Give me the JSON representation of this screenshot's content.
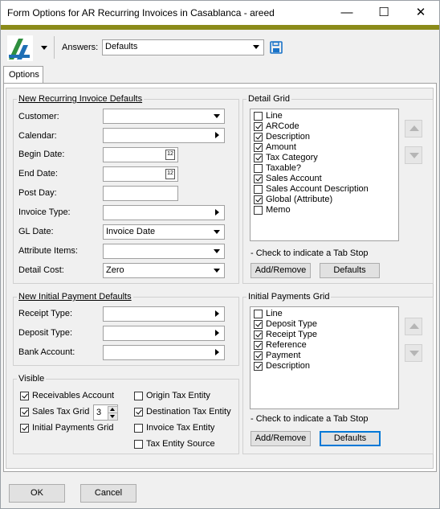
{
  "window": {
    "title": "Form Options for AR Recurring Invoices in Casablanca - areed",
    "minimize_glyph": "—",
    "maximize_glyph": "☐",
    "close_glyph": "✕"
  },
  "toolbar": {
    "answers_label": "Answers:",
    "answers_value": "Defaults",
    "save_icon": "floppy-disk-icon"
  },
  "tabs": [
    {
      "label": "Options"
    }
  ],
  "recurring_defaults": {
    "title": "New Recurring Invoice Defaults",
    "customer_label": "Customer:",
    "customer_value": "",
    "calendar_label": "Calendar:",
    "calendar_value": "",
    "begin_date_label": "Begin Date:",
    "begin_date_value": "",
    "end_date_label": "End Date:",
    "end_date_value": "",
    "post_day_label": "Post Day:",
    "post_day_value": "",
    "invoice_type_label": "Invoice Type:",
    "invoice_type_value": "",
    "gl_date_label": "GL Date:",
    "gl_date_value": "Invoice Date",
    "attribute_items_label": "Attribute Items:",
    "attribute_items_value": "",
    "detail_cost_label": "Detail Cost:",
    "detail_cost_value": "Zero",
    "calendar_icon_text": "12"
  },
  "detail_grid": {
    "title": "Detail Grid",
    "items": [
      {
        "label": "Line",
        "checked": false
      },
      {
        "label": "ARCode",
        "checked": true
      },
      {
        "label": "Description",
        "checked": true
      },
      {
        "label": "Amount",
        "checked": true
      },
      {
        "label": "Tax Category",
        "checked": true
      },
      {
        "label": "Taxable?",
        "checked": false
      },
      {
        "label": "Sales Account",
        "checked": true
      },
      {
        "label": "Sales Account Description",
        "checked": false
      },
      {
        "label": "Global (Attribute)",
        "checked": true
      },
      {
        "label": "Memo",
        "checked": false
      }
    ],
    "hint": "- Check to indicate a Tab Stop",
    "add_remove_label": "Add/Remove",
    "defaults_label": "Defaults"
  },
  "payment_defaults": {
    "title": "New Initial Payment Defaults",
    "receipt_type_label": "Receipt Type:",
    "receipt_type_value": "",
    "deposit_type_label": "Deposit Type:",
    "deposit_type_value": "",
    "bank_account_label": "Bank Account:",
    "bank_account_value": ""
  },
  "payments_grid": {
    "title": "Initial Payments Grid",
    "items": [
      {
        "label": "Line",
        "checked": false
      },
      {
        "label": "Deposit Type",
        "checked": true
      },
      {
        "label": "Receipt Type",
        "checked": true
      },
      {
        "label": "Reference",
        "checked": true
      },
      {
        "label": "Payment",
        "checked": true
      },
      {
        "label": "Description",
        "checked": true
      }
    ],
    "hint": "- Check to indicate a Tab Stop",
    "add_remove_label": "Add/Remove",
    "defaults_label": "Defaults"
  },
  "visible": {
    "title": "Visible",
    "receivables_account": {
      "label": "Receivables Account",
      "checked": true
    },
    "sales_tax_grid": {
      "label": "Sales Tax Grid",
      "checked": true,
      "value": "3"
    },
    "initial_payments_grid": {
      "label": "Initial Payments Grid",
      "checked": true
    },
    "origin_tax_entity": {
      "label": "Origin Tax Entity",
      "checked": false
    },
    "destination_tax_entity": {
      "label": "Destination Tax Entity",
      "checked": true
    },
    "invoice_tax_entity": {
      "label": "Invoice Tax Entity",
      "checked": false
    },
    "tax_entity_source": {
      "label": "Tax Entity Source",
      "checked": false
    }
  },
  "footer": {
    "ok_label": "OK",
    "cancel_label": "Cancel"
  }
}
